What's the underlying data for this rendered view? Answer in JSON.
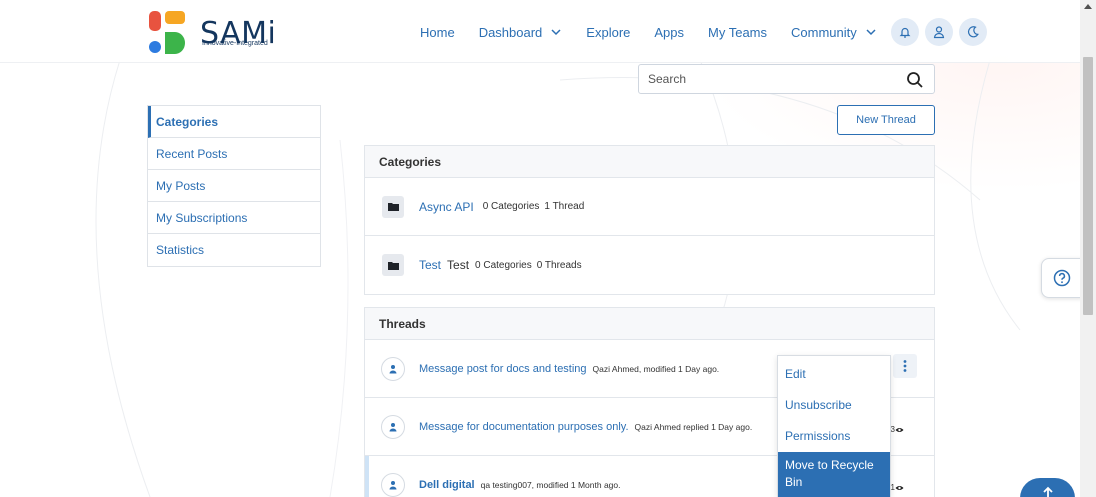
{
  "brand": {
    "name": "SAMi",
    "tagline": "Innovative-Integrated",
    "colors": {
      "red": "#e8533f",
      "orange": "#f6a623",
      "blue": "#2d7be0",
      "green": "#3cb44a"
    }
  },
  "nav": {
    "home": "Home",
    "dashboard": "Dashboard",
    "explore": "Explore",
    "apps": "Apps",
    "my_teams": "My Teams",
    "community": "Community"
  },
  "search": {
    "placeholder": "Search"
  },
  "sidebar": {
    "items": [
      {
        "label": "Categories",
        "active": true
      },
      {
        "label": "Recent Posts"
      },
      {
        "label": "My Posts"
      },
      {
        "label": "My Subscriptions"
      },
      {
        "label": "Statistics"
      }
    ]
  },
  "new_thread_label": "New Thread",
  "categories": {
    "heading": "Categories",
    "rows": [
      {
        "name": "Async API",
        "extra": "",
        "categories": "0 Categories",
        "threads": "1 Thread"
      },
      {
        "name": "Test",
        "extra": "Test",
        "categories": "0 Categories",
        "threads": "0 Threads"
      }
    ]
  },
  "threads": {
    "heading": "Threads",
    "rows": [
      {
        "title": "Message post for docs and testing",
        "meta": "Qazi Ahmed, modified 1 Day ago.",
        "views": ""
      },
      {
        "title": "Message for documentation purposes only.",
        "meta": "Qazi Ahmed replied 1 Day ago.",
        "views": "3"
      },
      {
        "title": "Dell digital",
        "meta": "qa testing007, modified 1 Month ago.",
        "views": "1"
      }
    ]
  },
  "context_menu": {
    "items": [
      "Edit",
      "Unsubscribe",
      "Permissions",
      "Move to Recycle Bin"
    ]
  },
  "accent_color": "#2c6fb3"
}
